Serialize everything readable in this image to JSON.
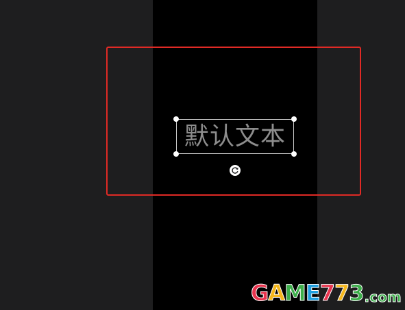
{
  "canvas": {
    "text_layer": {
      "content": "默认文本",
      "text_color": "#8d8d8d"
    },
    "highlight_color": "#e02a25",
    "rotate_icon": "rotate-icon"
  },
  "watermark": {
    "letters": [
      "G",
      "A",
      "M",
      "E",
      "7",
      "7",
      "3"
    ],
    "suffix": ".com",
    "colors": [
      "#e8344e",
      "#f5b71c",
      "#3cae4a",
      "#1e9fe0",
      "#e8344e",
      "#f5b71c",
      "#3cae4a"
    ]
  }
}
